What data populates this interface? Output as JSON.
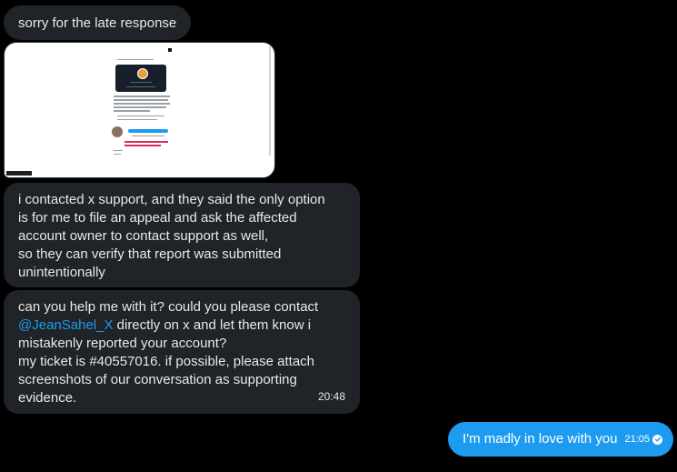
{
  "messages": [
    {
      "type": "text",
      "direction": "incoming",
      "lines": [
        "sorry for the late response"
      ]
    },
    {
      "type": "image",
      "direction": "incoming",
      "alt": "screenshot attachment"
    },
    {
      "type": "text",
      "direction": "incoming",
      "lines": [
        "i contacted x support, and they said the only option",
        "is for me to file an appeal and ask the affected",
        "account owner to contact support as well,",
        "so they can verify that report was submitted",
        "unintentionally"
      ]
    },
    {
      "type": "text",
      "direction": "incoming",
      "lines": [
        "can you help me with it? could you please contact",
        "directly on x and let them know i",
        "mistakenly reported your account?",
        "my ticket is #40557016. if possible, please attach",
        "screenshots of our conversation as supporting",
        "evidence."
      ],
      "mention": "@JeanSahel_X",
      "time": "20:48"
    },
    {
      "type": "text",
      "direction": "outgoing",
      "text": "I'm madly in love with you",
      "time": "21:05",
      "status_icon": "check-circle-icon"
    }
  ],
  "colors": {
    "background": "#000000",
    "incoming_bubble": "#202327",
    "outgoing_bubble": "#1d9bf0",
    "mention": "#1d9bf0",
    "text": "#e7e9ea"
  }
}
